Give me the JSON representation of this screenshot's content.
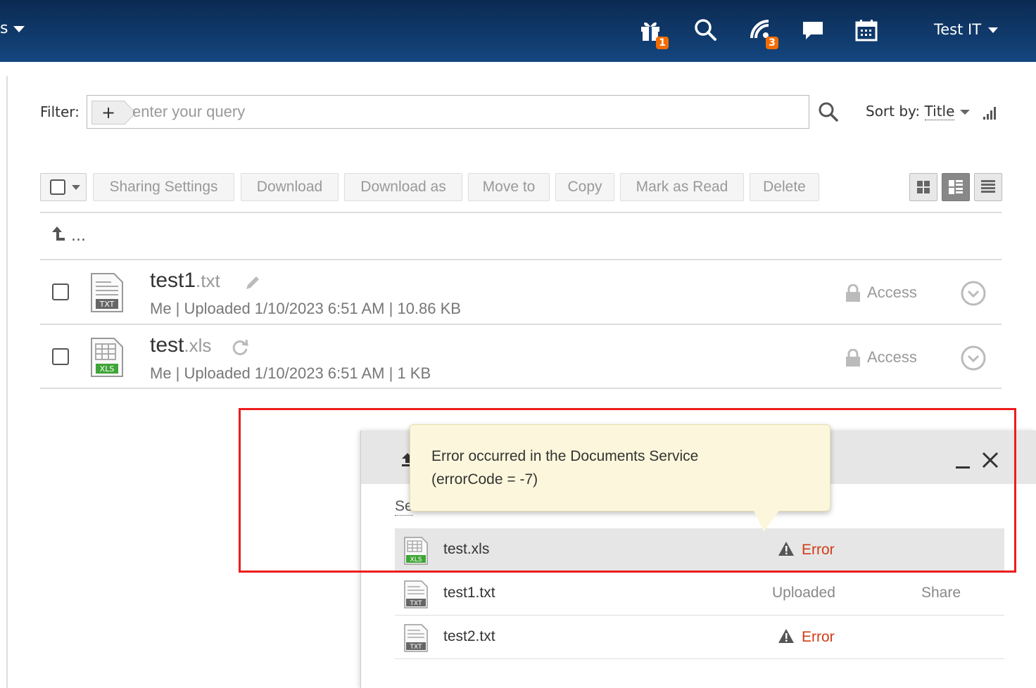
{
  "header": {
    "module_label": "s",
    "gift_badge": "1",
    "feed_badge": "3",
    "user_name": "Test IT"
  },
  "filter": {
    "label": "Filter:",
    "placeholder": "enter your query",
    "sort_prefix": "Sort by:",
    "sort_value": "Title"
  },
  "toolbar": {
    "buttons": [
      "Sharing Settings",
      "Download",
      "Download as",
      "Move to",
      "Copy",
      "Mark as Read",
      "Delete"
    ]
  },
  "up_level": "...",
  "files": [
    {
      "name": "test1",
      "ext": ".txt",
      "meta": "Me | Uploaded 1/10/2023 6:51 AM | 10.86 KB",
      "access": "Access",
      "icon": "txt-file-icon",
      "tool_icon": "pencil-icon"
    },
    {
      "name": "test",
      "ext": ".xls",
      "meta": "Me | Uploaded 1/10/2023 6:51 AM | 1 KB",
      "access": "Access",
      "icon": "xls-file-icon",
      "tool_icon": "refresh-icon"
    }
  ],
  "upload_panel": {
    "settings_label": "Se",
    "rows": [
      {
        "name": "test.xls",
        "status": "Error",
        "action": ""
      },
      {
        "name": "test1.txt",
        "status": "Uploaded",
        "action": "Share"
      },
      {
        "name": "test2.txt",
        "status": "Error",
        "action": ""
      }
    ]
  },
  "tooltip": {
    "line1": "Error occurred in the Documents Service",
    "line2": "(errorCode = -7)"
  },
  "colors": {
    "header": "#14467f",
    "badge": "#f36c00",
    "error": "#d03d17",
    "highlight": "#ee1c1c",
    "tooltip_bg": "#fcf7dc"
  }
}
